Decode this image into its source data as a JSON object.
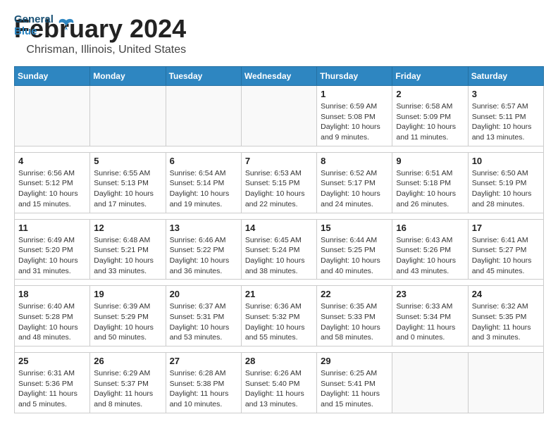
{
  "app": {
    "name": "GeneralBlue",
    "logo_text_1": "General",
    "logo_text_2": "Blue"
  },
  "header": {
    "month_year": "February 2024",
    "location": "Chrisman, Illinois, United States"
  },
  "weekdays": [
    "Sunday",
    "Monday",
    "Tuesday",
    "Wednesday",
    "Thursday",
    "Friday",
    "Saturday"
  ],
  "weeks": [
    [
      {
        "day": "",
        "info": ""
      },
      {
        "day": "",
        "info": ""
      },
      {
        "day": "",
        "info": ""
      },
      {
        "day": "",
        "info": ""
      },
      {
        "day": "1",
        "info": "Sunrise: 6:59 AM\nSunset: 5:08 PM\nDaylight: 10 hours and 9 minutes."
      },
      {
        "day": "2",
        "info": "Sunrise: 6:58 AM\nSunset: 5:09 PM\nDaylight: 10 hours and 11 minutes."
      },
      {
        "day": "3",
        "info": "Sunrise: 6:57 AM\nSunset: 5:11 PM\nDaylight: 10 hours and 13 minutes."
      }
    ],
    [
      {
        "day": "4",
        "info": "Sunrise: 6:56 AM\nSunset: 5:12 PM\nDaylight: 10 hours and 15 minutes."
      },
      {
        "day": "5",
        "info": "Sunrise: 6:55 AM\nSunset: 5:13 PM\nDaylight: 10 hours and 17 minutes."
      },
      {
        "day": "6",
        "info": "Sunrise: 6:54 AM\nSunset: 5:14 PM\nDaylight: 10 hours and 19 minutes."
      },
      {
        "day": "7",
        "info": "Sunrise: 6:53 AM\nSunset: 5:15 PM\nDaylight: 10 hours and 22 minutes."
      },
      {
        "day": "8",
        "info": "Sunrise: 6:52 AM\nSunset: 5:17 PM\nDaylight: 10 hours and 24 minutes."
      },
      {
        "day": "9",
        "info": "Sunrise: 6:51 AM\nSunset: 5:18 PM\nDaylight: 10 hours and 26 minutes."
      },
      {
        "day": "10",
        "info": "Sunrise: 6:50 AM\nSunset: 5:19 PM\nDaylight: 10 hours and 28 minutes."
      }
    ],
    [
      {
        "day": "11",
        "info": "Sunrise: 6:49 AM\nSunset: 5:20 PM\nDaylight: 10 hours and 31 minutes."
      },
      {
        "day": "12",
        "info": "Sunrise: 6:48 AM\nSunset: 5:21 PM\nDaylight: 10 hours and 33 minutes."
      },
      {
        "day": "13",
        "info": "Sunrise: 6:46 AM\nSunset: 5:22 PM\nDaylight: 10 hours and 36 minutes."
      },
      {
        "day": "14",
        "info": "Sunrise: 6:45 AM\nSunset: 5:24 PM\nDaylight: 10 hours and 38 minutes."
      },
      {
        "day": "15",
        "info": "Sunrise: 6:44 AM\nSunset: 5:25 PM\nDaylight: 10 hours and 40 minutes."
      },
      {
        "day": "16",
        "info": "Sunrise: 6:43 AM\nSunset: 5:26 PM\nDaylight: 10 hours and 43 minutes."
      },
      {
        "day": "17",
        "info": "Sunrise: 6:41 AM\nSunset: 5:27 PM\nDaylight: 10 hours and 45 minutes."
      }
    ],
    [
      {
        "day": "18",
        "info": "Sunrise: 6:40 AM\nSunset: 5:28 PM\nDaylight: 10 hours and 48 minutes."
      },
      {
        "day": "19",
        "info": "Sunrise: 6:39 AM\nSunset: 5:29 PM\nDaylight: 10 hours and 50 minutes."
      },
      {
        "day": "20",
        "info": "Sunrise: 6:37 AM\nSunset: 5:31 PM\nDaylight: 10 hours and 53 minutes."
      },
      {
        "day": "21",
        "info": "Sunrise: 6:36 AM\nSunset: 5:32 PM\nDaylight: 10 hours and 55 minutes."
      },
      {
        "day": "22",
        "info": "Sunrise: 6:35 AM\nSunset: 5:33 PM\nDaylight: 10 hours and 58 minutes."
      },
      {
        "day": "23",
        "info": "Sunrise: 6:33 AM\nSunset: 5:34 PM\nDaylight: 11 hours and 0 minutes."
      },
      {
        "day": "24",
        "info": "Sunrise: 6:32 AM\nSunset: 5:35 PM\nDaylight: 11 hours and 3 minutes."
      }
    ],
    [
      {
        "day": "25",
        "info": "Sunrise: 6:31 AM\nSunset: 5:36 PM\nDaylight: 11 hours and 5 minutes."
      },
      {
        "day": "26",
        "info": "Sunrise: 6:29 AM\nSunset: 5:37 PM\nDaylight: 11 hours and 8 minutes."
      },
      {
        "day": "27",
        "info": "Sunrise: 6:28 AM\nSunset: 5:38 PM\nDaylight: 11 hours and 10 minutes."
      },
      {
        "day": "28",
        "info": "Sunrise: 6:26 AM\nSunset: 5:40 PM\nDaylight: 11 hours and 13 minutes."
      },
      {
        "day": "29",
        "info": "Sunrise: 6:25 AM\nSunset: 5:41 PM\nDaylight: 11 hours and 15 minutes."
      },
      {
        "day": "",
        "info": ""
      },
      {
        "day": "",
        "info": ""
      }
    ]
  ]
}
